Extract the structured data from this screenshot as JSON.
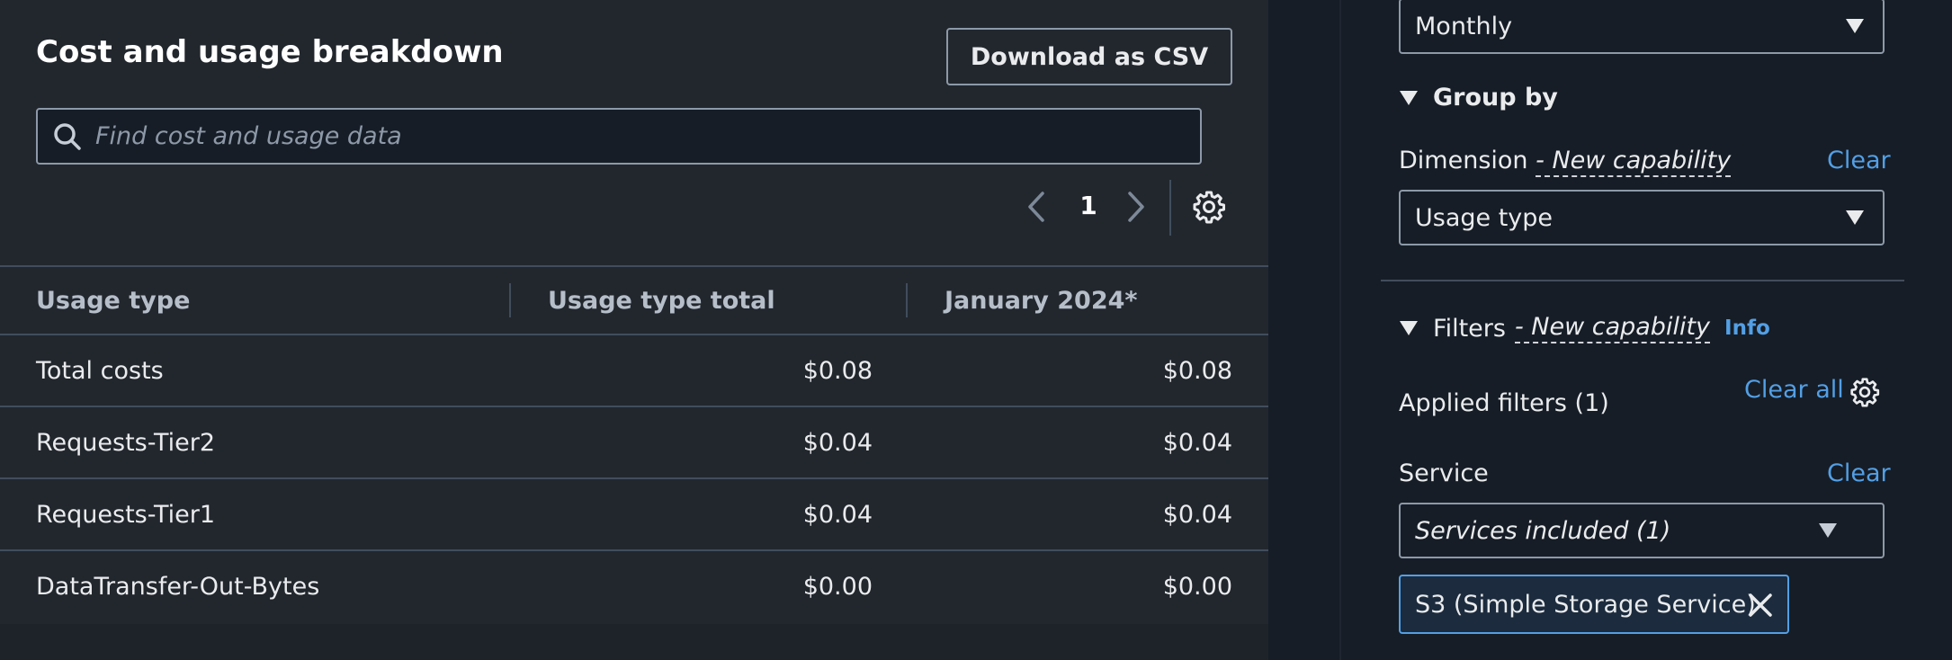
{
  "breakdown": {
    "title": "Cost and usage breakdown",
    "download_label": "Download as CSV",
    "search_placeholder": "Find cost and usage data",
    "page_number": "1",
    "columns": [
      "Usage type",
      "Usage type total",
      "January 2024*"
    ],
    "rows": [
      {
        "usage_type": "Total costs",
        "total": "$0.08",
        "jan_2024": "$0.08"
      },
      {
        "usage_type": "Requests-Tier2",
        "total": "$0.04",
        "jan_2024": "$0.04"
      },
      {
        "usage_type": "Requests-Tier1",
        "total": "$0.04",
        "jan_2024": "$0.04"
      },
      {
        "usage_type": "DataTransfer-Out-Bytes",
        "total": "$0.00",
        "jan_2024": "$0.00"
      }
    ]
  },
  "sidebar": {
    "granularity_value": "Monthly",
    "group_by": {
      "heading": "Group by",
      "dimension_label": "Dimension",
      "dimension_suffix": "- New capability",
      "clear_label": "Clear",
      "dimension_value": "Usage type"
    },
    "filters": {
      "heading": "Filters",
      "heading_suffix": "- New capability",
      "info_label": "Info",
      "applied_label": "Applied filters (1)",
      "clear_all_label": "Clear all",
      "service_label": "Service",
      "service_clear_label": "Clear",
      "service_value": "Services included (1)",
      "token_label": "S3 (Simple Storage Service)"
    }
  },
  "colors": {
    "panel_bg": "#22272e",
    "page_bg": "#161d26",
    "border": "#8d99a8",
    "link": "#539fe5",
    "token_bg": "#1c2b3d"
  }
}
